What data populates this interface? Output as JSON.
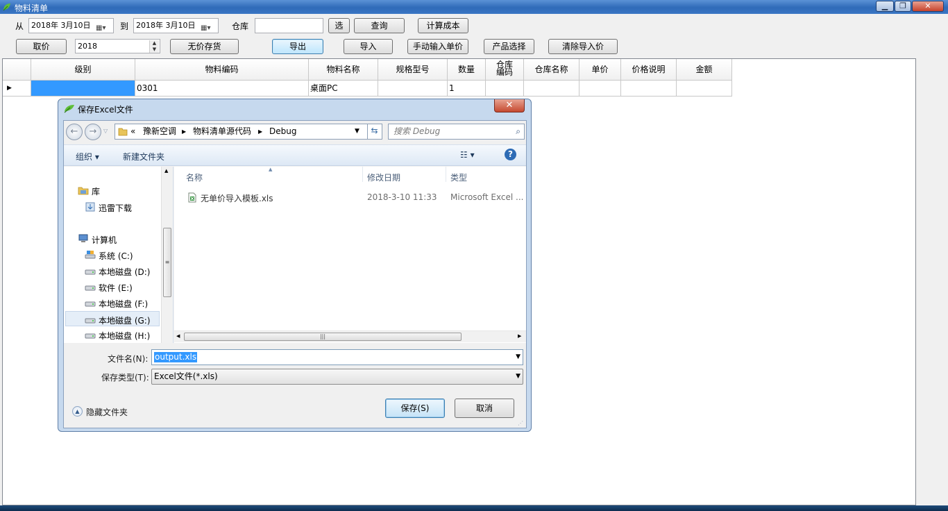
{
  "window": {
    "title": "物料清单",
    "controls": {
      "minimize": "▁",
      "maximize": "❐",
      "close": "✕"
    }
  },
  "toolbar": {
    "from_label": "从",
    "from_date": "2018年 3月10日",
    "to_label": "到",
    "to_date": "2018年 3月10日",
    "warehouse_label": "仓库",
    "warehouse_value": "",
    "select_btn": "选",
    "query_btn": "查询",
    "calc_cost_btn": "计算成本",
    "get_price_btn": "取价",
    "year_value": "2018",
    "no_price_stock_btn": "无价存货",
    "export_btn": "导出",
    "import_btn": "导入",
    "manual_price_btn": "手动输入单价",
    "product_select_btn": "产品选择",
    "clear_import_btn": "清除导入价"
  },
  "grid": {
    "columns": [
      "级别",
      "物料编码",
      "物料名称",
      "规格型号",
      "数量",
      "仓库\n编码",
      "仓库名称",
      "单价",
      "价格说明",
      "金额"
    ],
    "row_marker": "▶",
    "rows": [
      [
        "",
        "0301",
        "桌面PC",
        "",
        "1",
        "",
        "",
        "",
        "",
        ""
      ]
    ]
  },
  "dialog": {
    "title": "保存Excel文件",
    "close": "✕",
    "path": [
      "«",
      "豫新空调",
      "物料清单源代码",
      "Debug"
    ],
    "search_placeholder": "搜索 Debug",
    "organize": "组织 ▾",
    "new_folder": "新建文件夹",
    "nav": {
      "library": "库",
      "thunder": "迅雷下载",
      "computer": "计算机",
      "drives": [
        "系统 (C:)",
        "本地磁盘 (D:)",
        "软件 (E:)",
        "本地磁盘 (F:)",
        "本地磁盘 (G:)",
        "本地磁盘 (H:)"
      ]
    },
    "file_columns": {
      "name": "名称",
      "date": "修改日期",
      "type": "类型"
    },
    "files": [
      {
        "name": "无单价导入模板.xls",
        "date": "2018-3-10 11:33",
        "type": "Microsoft Excel ..."
      }
    ],
    "filename_label": "文件名(N):",
    "filename_value": "output.xls",
    "filetype_label": "保存类型(T):",
    "filetype_value": "Excel文件(*.xls)",
    "hide_folders": "隐藏文件夹",
    "save_btn": "保存(S)",
    "cancel_btn": "取消"
  },
  "colors": {
    "accent": "#3399ff",
    "title_bar": "#2f6ab8",
    "close_red": "#c54a30"
  }
}
